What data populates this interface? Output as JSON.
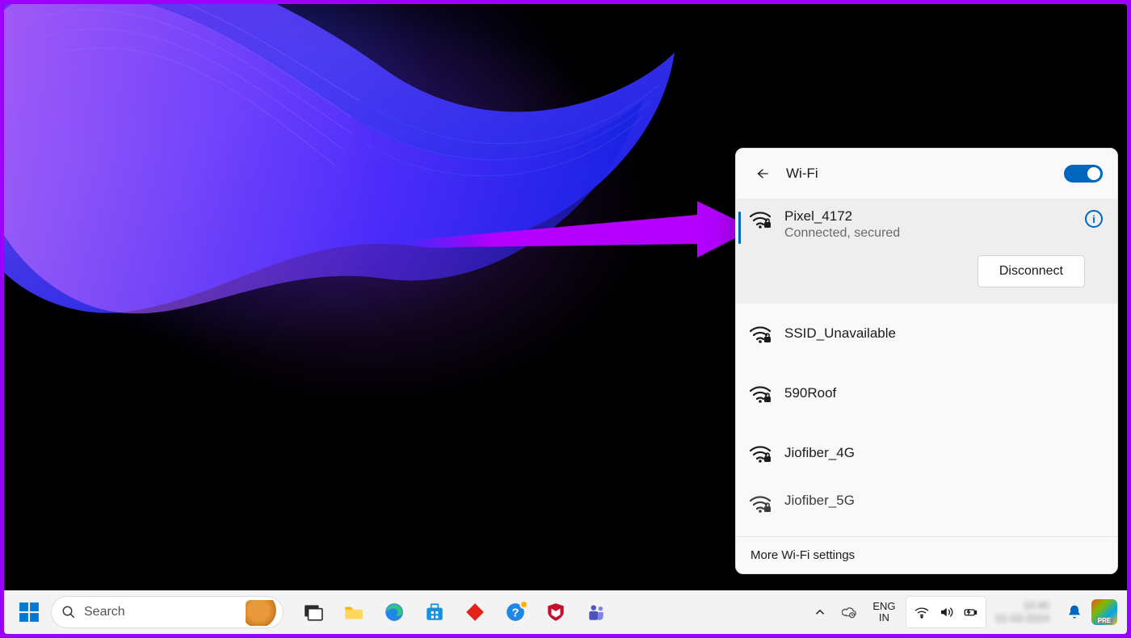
{
  "wifi_panel": {
    "title": "Wi-Fi",
    "toggle_on": true,
    "connected": {
      "name": "Pixel_4172",
      "status": "Connected, secured",
      "disconnect_label": "Disconnect"
    },
    "networks": [
      {
        "name": "SSID_Unavailable"
      },
      {
        "name": "590Roof"
      },
      {
        "name": "Jiofiber_4G"
      },
      {
        "name": "Jiofiber_5G"
      }
    ],
    "more_settings": "More Wi-Fi settings",
    "info_glyph": "i"
  },
  "taskbar": {
    "search_placeholder": "Search",
    "language": {
      "line1": "ENG",
      "line2": "IN"
    },
    "clock": {
      "time": "10:40",
      "date": "01-03-2024"
    },
    "ms365_badge": "PRE"
  },
  "colors": {
    "accent": "#0067C0",
    "annotation": "#B400FF"
  }
}
